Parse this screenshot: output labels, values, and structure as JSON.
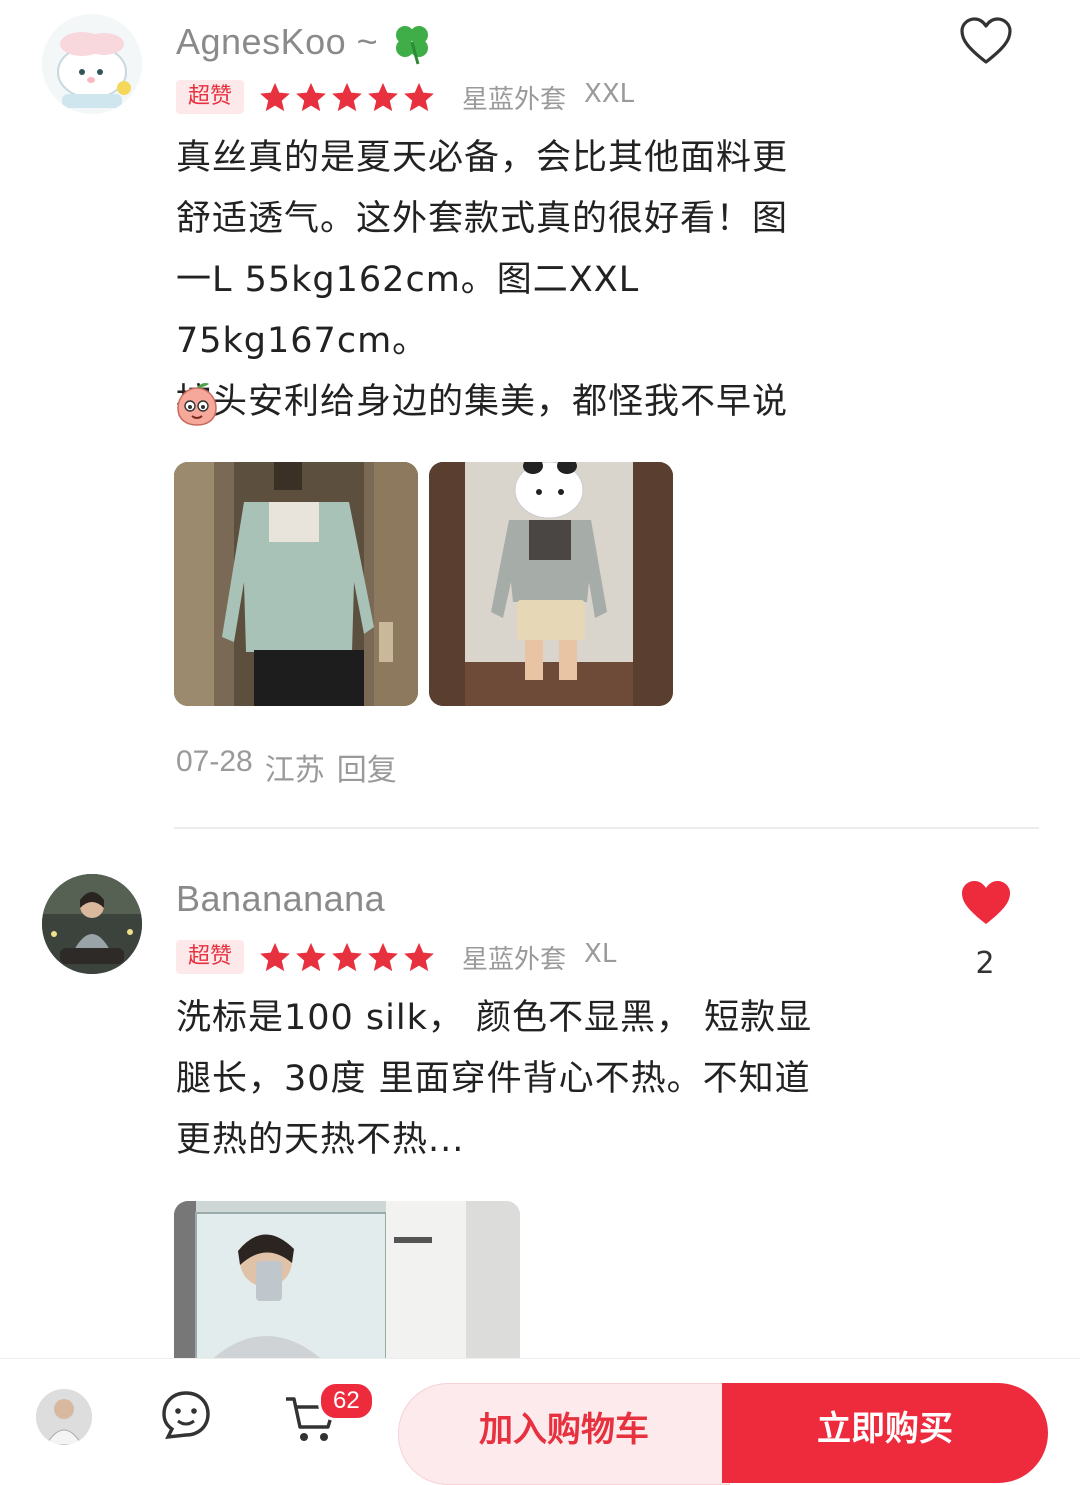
{
  "reviews": [
    {
      "username": "AgnesKoo ~",
      "badge": "超赞",
      "rating": 5,
      "variant_color": "星蓝外套",
      "variant_size": "XXL",
      "text_lines": [
        "真丝真的是夏天必备，会比其他面料更",
        "舒适透气。这外套款式真的很好看！图",
        "一L 55kg162cm。图二XXL 75kg167cm。",
        "按头安利给身边的集美，都怪我不早说"
      ],
      "date": "07-28",
      "location": "江苏",
      "reply_label": "回复",
      "liked": false,
      "like_count": ""
    },
    {
      "username": "Banananana",
      "badge": "超赞",
      "rating": 5,
      "variant_color": "星蓝外套",
      "variant_size": "XL",
      "text_lines": [
        "洗标是100 silk， 颜色不显黑， 短款显",
        "腿长，30度 里面穿件背心不热。不知道",
        "更热的天热不热..."
      ],
      "liked": true,
      "like_count": "2"
    }
  ],
  "bottom_bar": {
    "cart_count": "62",
    "add_to_cart_label": "加入购物车",
    "buy_now_label": "立即购买"
  },
  "colors": {
    "accent": "#ee2b3d",
    "star": "#e8313f",
    "badge_bg": "#fde8ea"
  }
}
